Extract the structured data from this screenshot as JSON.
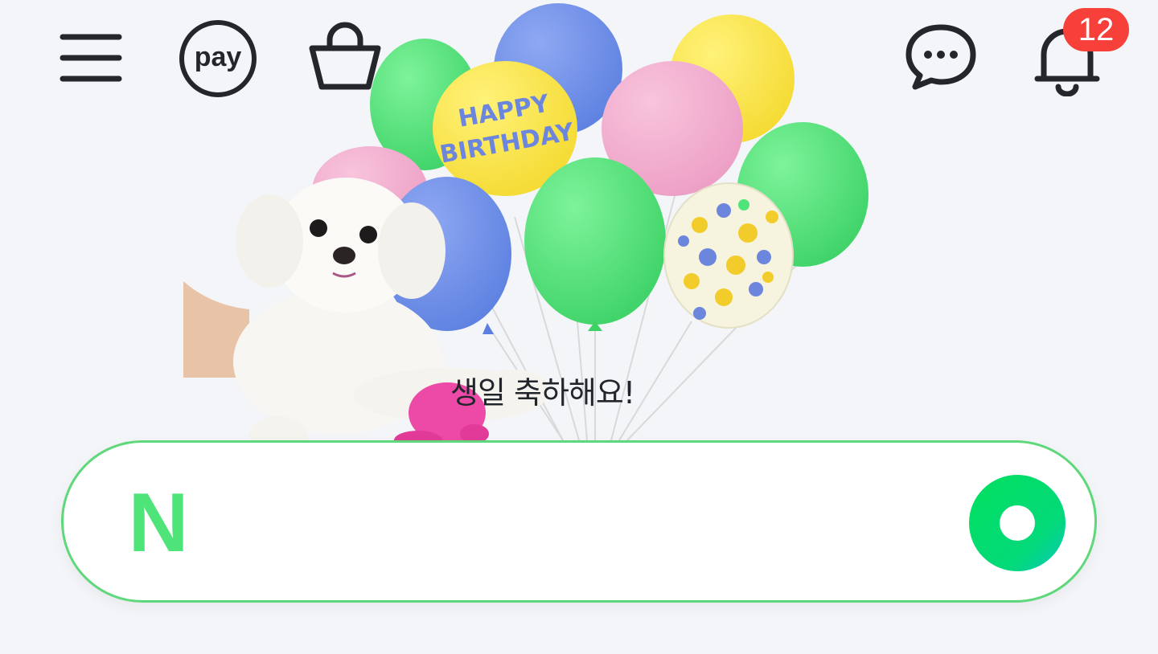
{
  "header": {
    "menu_icon": "hamburger-menu-icon",
    "pay_label": "pay",
    "cart_icon": "shopping-bag-icon",
    "talk_icon": "chat-bubble-icon",
    "notification_icon": "bell-icon",
    "notification_count": "12"
  },
  "banner": {
    "balloon_text_line1": "HAPPY",
    "balloon_text_line2": "BIRTHDAY",
    "greeting": "생일 축하해요!"
  },
  "search": {
    "logo_letter": "N",
    "placeholder": "",
    "value": "",
    "button_icon": "search-ring-icon"
  },
  "colors": {
    "background": "#f3f5f8",
    "accent_green": "#4ee47a",
    "badge_red": "#f8403a",
    "icon_dark": "#24262b"
  }
}
